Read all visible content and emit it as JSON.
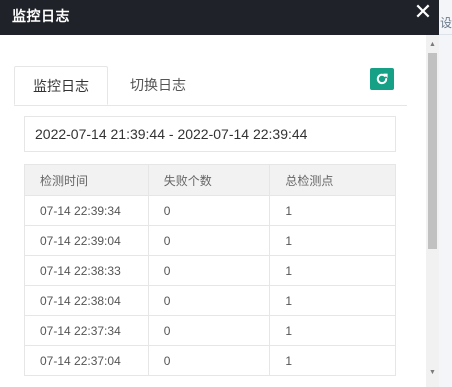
{
  "modal": {
    "title": "监控日志",
    "close_glyph": "✕"
  },
  "tabs": [
    {
      "label": "监控日志",
      "active": true
    },
    {
      "label": "切换日志",
      "active": false
    }
  ],
  "refresh_icon": "refresh-icon",
  "date_range": "2022-07-14 21:39:44 - 2022-07-14 22:39:44",
  "table": {
    "headers": [
      "检测时间",
      "失败个数",
      "总检测点"
    ],
    "rows": [
      [
        "07-14 22:39:34",
        "0",
        "1"
      ],
      [
        "07-14 22:39:04",
        "0",
        "1"
      ],
      [
        "07-14 22:38:33",
        "0",
        "1"
      ],
      [
        "07-14 22:38:04",
        "0",
        "1"
      ],
      [
        "07-14 22:37:34",
        "0",
        "1"
      ],
      [
        "07-14 22:37:04",
        "0",
        "1"
      ]
    ]
  },
  "background_fragment": "设置",
  "colors": {
    "titlebar": "#1f2228",
    "accent": "#16a085"
  }
}
